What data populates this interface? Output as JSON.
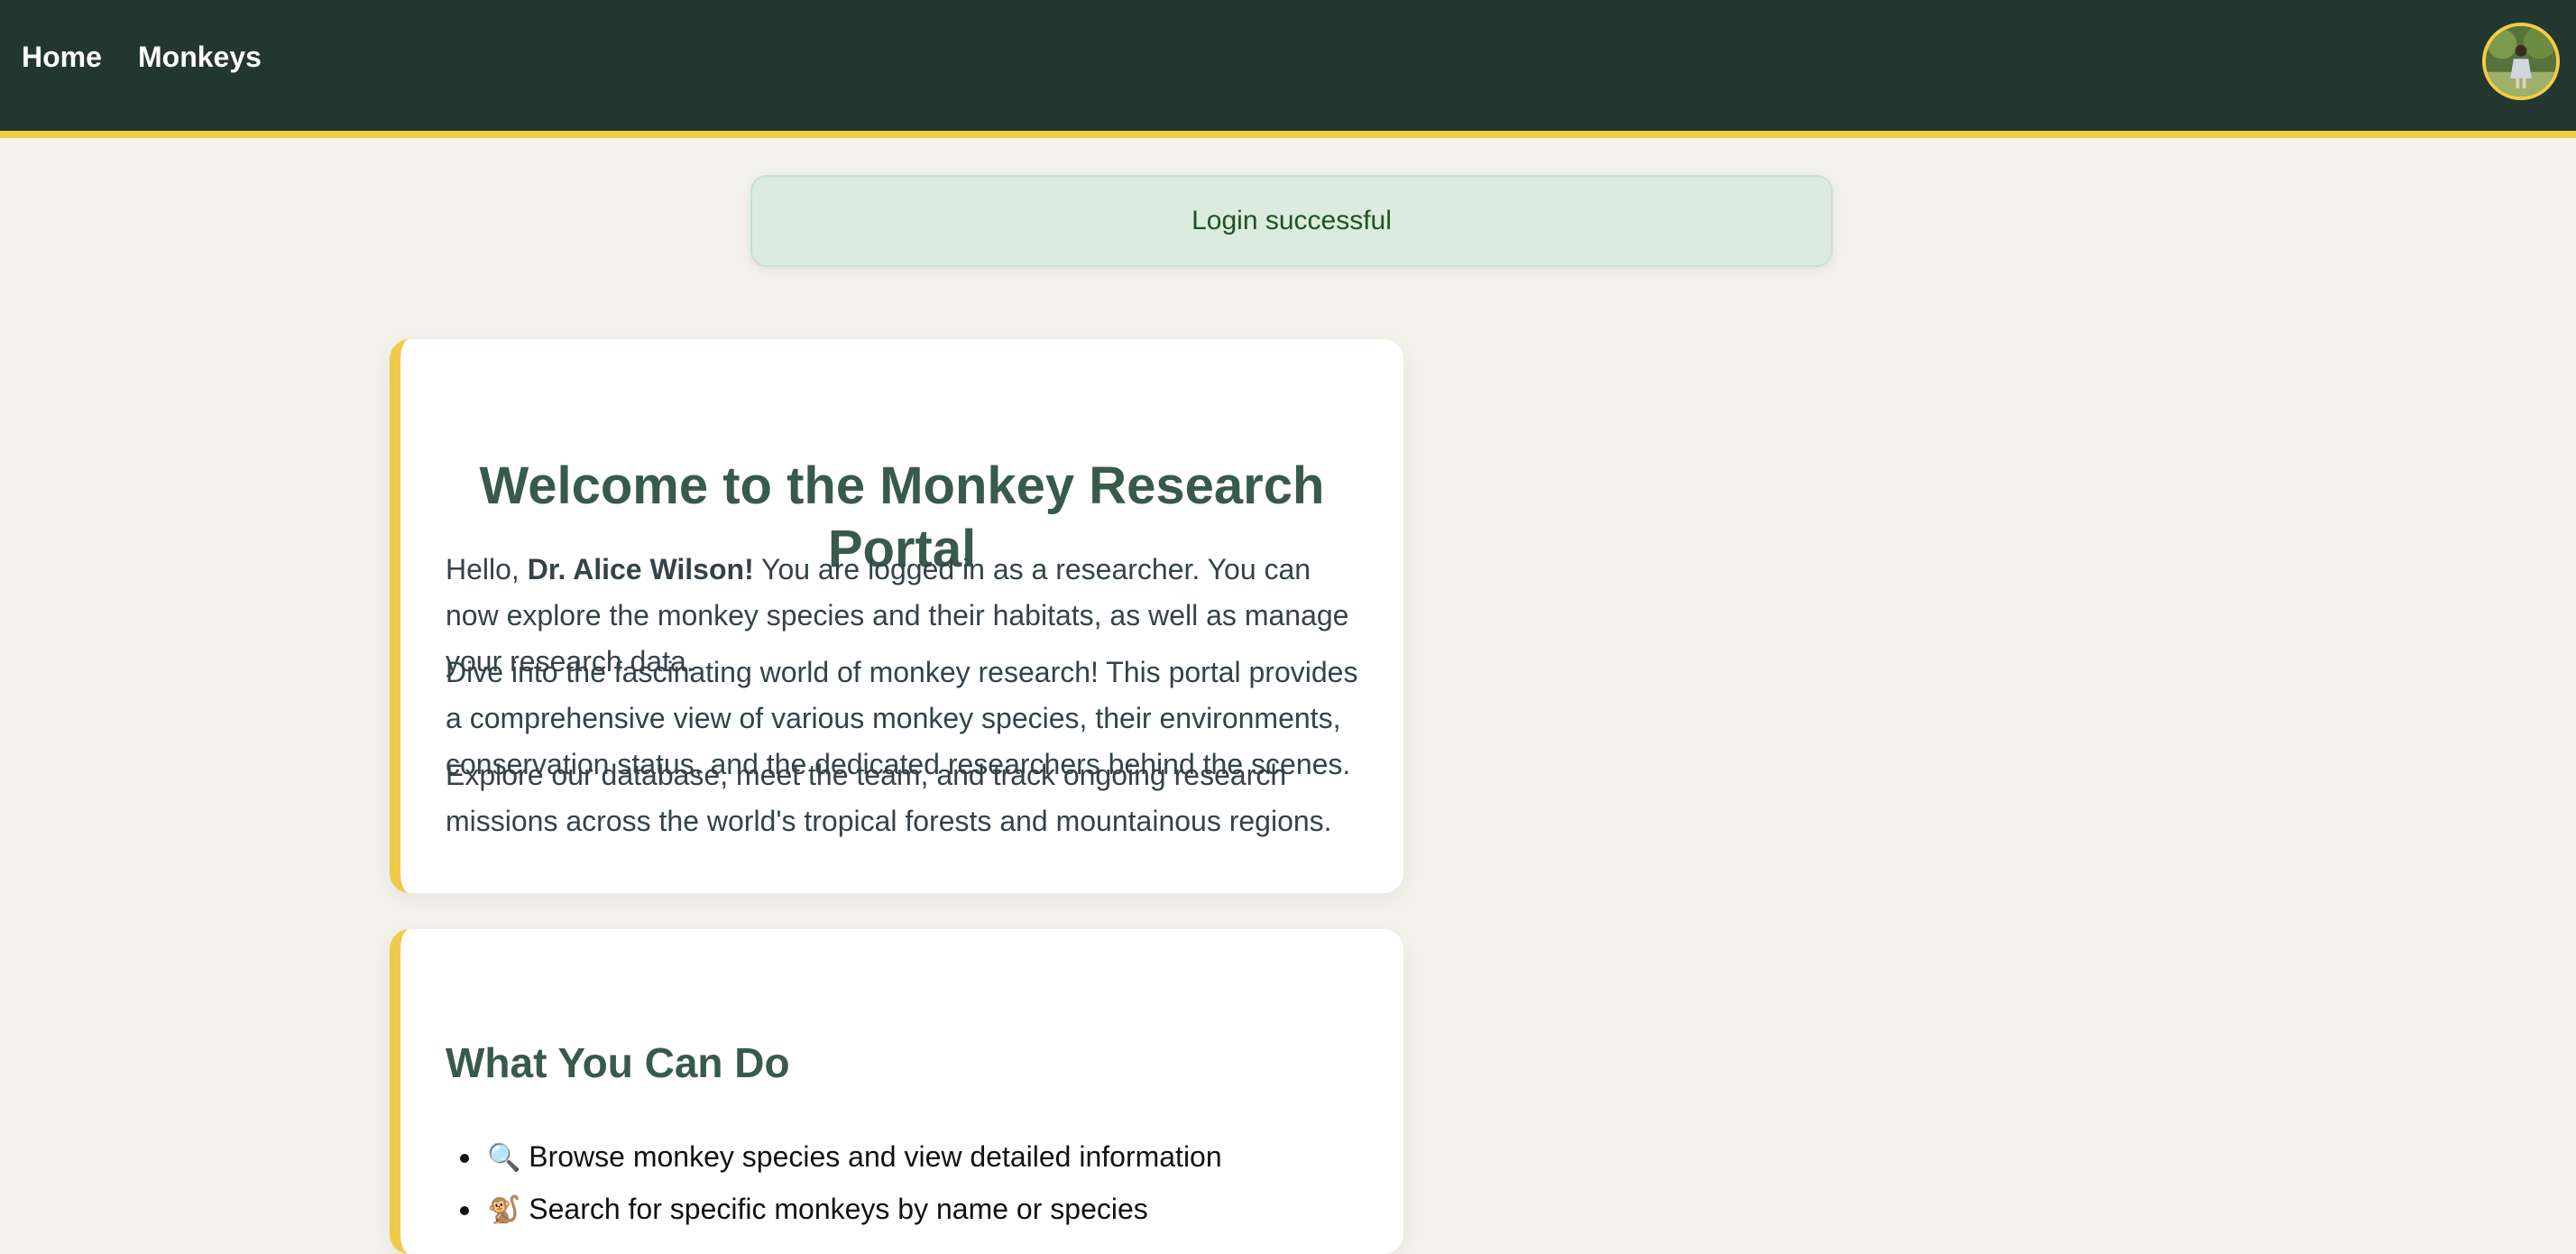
{
  "nav": {
    "home_label": "Home",
    "monkeys_label": "Monkeys"
  },
  "avatar": {
    "alt": "user-avatar"
  },
  "flash": {
    "message": "Login successful"
  },
  "welcome": {
    "title": "Welcome to the Monkey Research Portal",
    "greeting_prefix": "Hello, ",
    "user_name": "Dr. Alice Wilson!",
    "greeting_suffix": " You are logged in as a researcher. You can now explore the monkey species and their habitats, as well as manage your research data.",
    "paragraph2": "Dive into the fascinating world of monkey research! This portal provides a comprehensive view of various monkey species, their environments, conservation status, and the dedicated researchers behind the scenes.",
    "paragraph3": "Explore our database, meet the team, and track ongoing research missions across the world's tropical forests and mountainous regions."
  },
  "what_you_can_do": {
    "title": "What You Can Do",
    "items": [
      {
        "icon": "🔍",
        "icon_name": "magnifier-icon",
        "text": "Browse monkey species and view detailed information"
      },
      {
        "icon": "🐒",
        "icon_name": "monkey-icon",
        "text": "Search for specific monkeys by name or species"
      }
    ]
  },
  "colors": {
    "navbar": "#233730",
    "accent": "#f3cc47",
    "heading": "#385a4b",
    "flash_bg": "#dbebdd",
    "flash_text": "#1f5223",
    "page_bg": "#f2f1ea"
  }
}
